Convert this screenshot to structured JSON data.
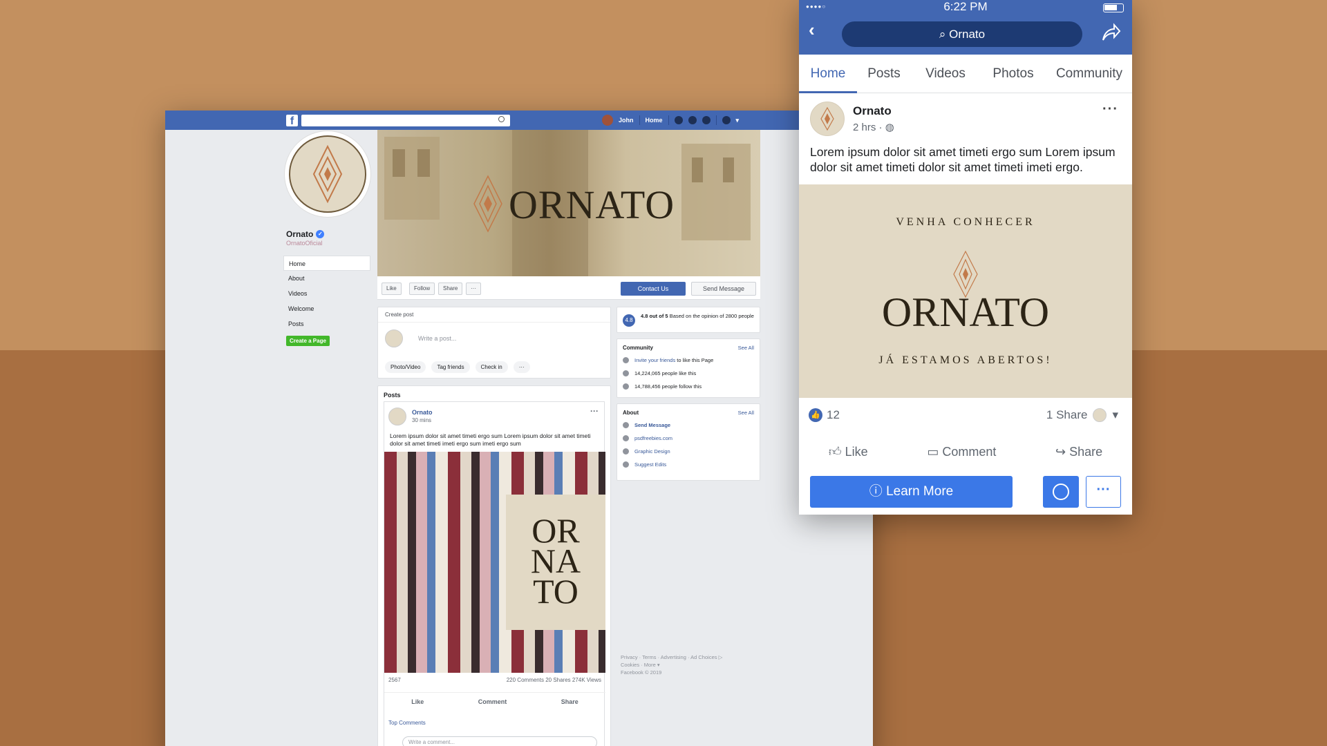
{
  "desktop": {
    "topbar": {
      "user": "John",
      "home": "Home"
    },
    "page": {
      "name": "Ornato",
      "handle": "OrnatoOficial"
    },
    "menu": [
      {
        "label": "Home"
      },
      {
        "label": "About"
      },
      {
        "label": "Videos"
      },
      {
        "label": "Welcome"
      },
      {
        "label": "Posts"
      }
    ],
    "create_page": "Create a Page",
    "cover_brand": "ORNATO",
    "actions": {
      "like": "Like",
      "follow": "Follow",
      "share": "Share",
      "more": "···",
      "contact": "Contact Us",
      "message": "Send Message"
    },
    "create_post": {
      "title": "Create post",
      "placeholder": "Write a post...",
      "photo": "Photo/Video",
      "tag": "Tag friends",
      "checkin": "Check in",
      "more": "···"
    },
    "posts": {
      "heading": "Posts",
      "author": "Ornato",
      "time": "30 mins",
      "text": "Lorem ipsum dolor sit amet timeti ergo sum Lorem ipsum dolor sit amet timeti dolor sit amet timeti imeti ergo sum imeti ergo sum",
      "image_brand_lines": [
        "OR",
        "NA",
        "TO"
      ],
      "reactions": "2567",
      "stats": "220 Comments  20 Shares  274K Views",
      "like": "Like",
      "comment": "Comment",
      "share": "Share",
      "top_comments": "Top Comments",
      "comment_placeholder": "Write a comment..."
    },
    "rating": {
      "score": "4.8",
      "text_bold": "4.8 out of 5",
      "text_rest": "Based on the opinion of 2800 people"
    },
    "community": {
      "heading": "Community",
      "see_all": "See All",
      "invite_link": "Invite your friends",
      "invite_rest": "to like this Page",
      "likes": "14,224,065 people like this",
      "follows": "14,788,456 people follow this"
    },
    "about": {
      "heading": "About",
      "see_all": "See All",
      "send_message": "Send Message",
      "website": "psdfreebies.com",
      "category": "Graphic Design",
      "suggest": "Suggest Edits"
    },
    "footer": {
      "line1": "Privacy · Terms · Advertising · Ad Choices ▷",
      "line2": "Cookies · More ▾",
      "line3": "Facebook © 2019"
    }
  },
  "mobile": {
    "status": {
      "time": "6:22 PM",
      "signal": "●●●●○"
    },
    "search": "Ornato",
    "tabs": [
      {
        "label": "Home"
      },
      {
        "label": "Posts"
      },
      {
        "label": "Videos"
      },
      {
        "label": "Photos"
      },
      {
        "label": "Community"
      }
    ],
    "post": {
      "author": "Ornato",
      "time": "2 hrs ·",
      "text": "Lorem ipsum dolor sit amet timeti ergo sum Lorem ipsum dolor sit amet timeti dolor sit amet timeti imeti ergo.",
      "img_top": "VENHA CONHECER",
      "img_brand": "ORNATO",
      "img_bottom": "JÁ ESTAMOS ABERTOS!",
      "likes": "12",
      "shares": "1 Share",
      "like": "Like",
      "comment": "Comment",
      "share": "Share",
      "learn_more": "Learn More",
      "more": "···"
    }
  },
  "colors": {
    "fb_blue": "#4267b2",
    "brand_beige": "#e2d9c5",
    "brand_copper": "#c27a4a",
    "bg_top": "#c3905f",
    "bg_bottom": "#a86f41"
  }
}
